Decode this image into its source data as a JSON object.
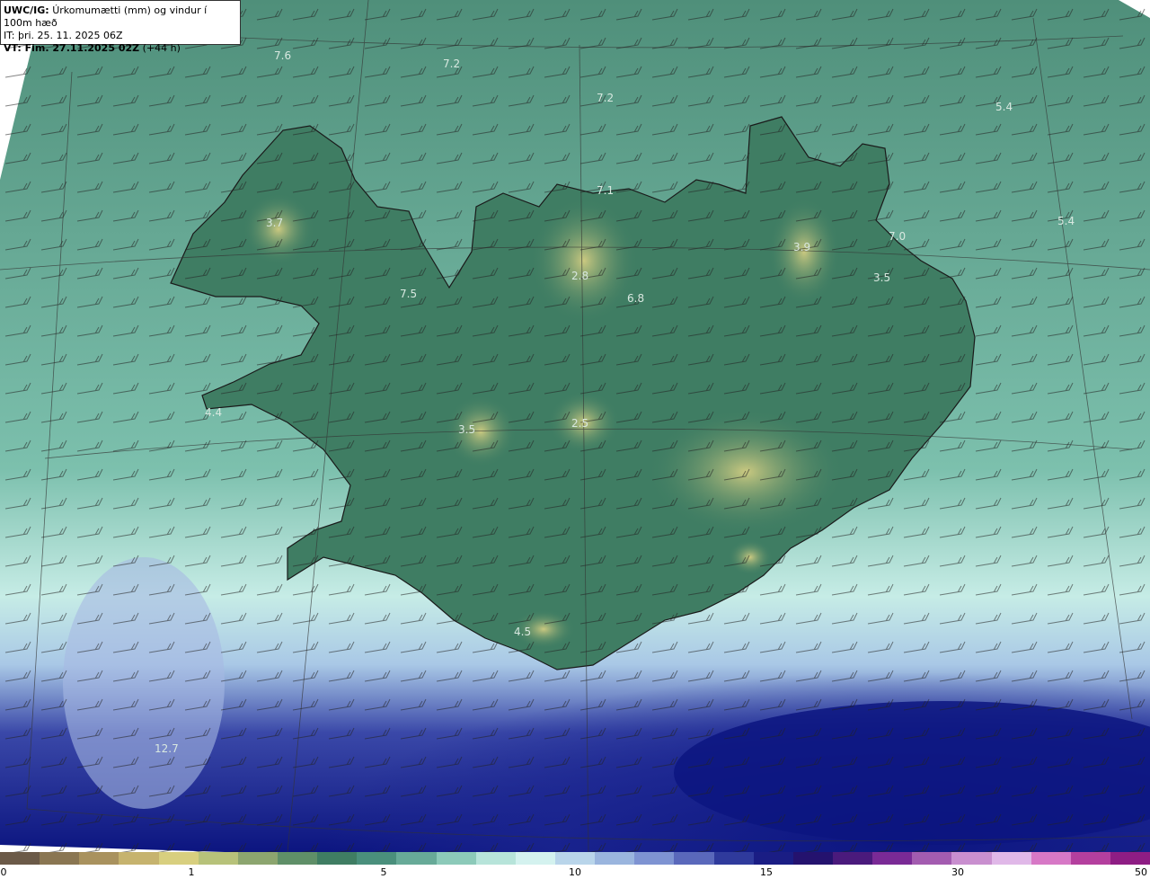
{
  "header": {
    "model": "UWC/IG:",
    "description": "Úrkomumætti (mm) og vindur í 100m hæð",
    "init_time": "IT: þri. 25. 11. 2025 06Z",
    "valid_prefix": "VT: Fim. 27.11.2025 02Z",
    "valid_suffix": "(+44 h)"
  },
  "map_labels": [
    "7.6",
    "7.2",
    "7.2",
    "5.4",
    "7.1",
    "3.7",
    "5.4",
    "7.0",
    "3.9",
    "2.8",
    "3.5",
    "6.8",
    "7.5",
    "4.4",
    "3.5",
    "2.5",
    "4.5",
    "12.7"
  ],
  "colorbar": {
    "colors": [
      "#6b5a48",
      "#8a7652",
      "#a9925e",
      "#c6b36e",
      "#d8cf7f",
      "#b7c27a",
      "#8ca56f",
      "#5f8f68",
      "#3f7d63",
      "#4a8f7c",
      "#67aa98",
      "#8ccab9",
      "#b7e4da",
      "#d4f2ef",
      "#b9d5ea",
      "#9ab5de",
      "#7e93d2",
      "#5a68bb",
      "#2f3a9c",
      "#1a1d84",
      "#24126e",
      "#4a1a7c",
      "#7a2a96",
      "#a35cb0",
      "#c98fcf",
      "#e0b8e8",
      "#d778c6",
      "#b43f9e",
      "#8e1d84"
    ],
    "ticks": [
      "0",
      "1",
      "5",
      "10",
      "15",
      "30",
      "50"
    ]
  },
  "colors": {
    "sea_green": "#5a9a84",
    "land_yellow": "#c9c47a",
    "heavy_blue": "#0c1580",
    "light_cyan": "#c6ece6"
  }
}
